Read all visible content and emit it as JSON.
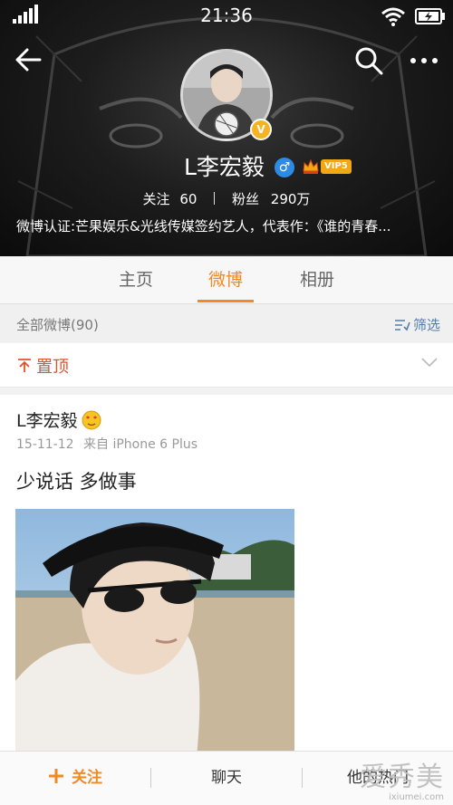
{
  "status_bar": {
    "time": "21:36"
  },
  "profile": {
    "name": "L李宏毅",
    "verified_mark": "V",
    "vip_label": "VIP5",
    "gender_symbol": "♂",
    "following_label": "关注",
    "following_count": "60",
    "followers_label": "粉丝",
    "followers_count": "290万",
    "bio": "微博认证:芒果娱乐&光线传媒签约艺人，代表作：《谁的青春..."
  },
  "tabs": [
    {
      "label": "主页",
      "active": false
    },
    {
      "label": "微博",
      "active": true
    },
    {
      "label": "相册",
      "active": false
    }
  ],
  "filter": {
    "all_posts": "全部微博(90)",
    "filter_label": "筛选"
  },
  "pinned": {
    "label": "置顶"
  },
  "post": {
    "author": "L李宏毅",
    "date": "15-11-12",
    "source": "来自 iPhone 6 Plus",
    "text": "少说话 多做事"
  },
  "bottom_bar": {
    "follow": "关注",
    "chat": "聊天",
    "hot": "他的热门"
  },
  "watermark": {
    "cn": "爱秀美",
    "url": "ixiumei.com"
  },
  "icons": [
    "back-arrow-icon",
    "search-icon",
    "more-icon",
    "signal-icon",
    "wifi-icon",
    "battery-icon",
    "gender-icon",
    "vip-crown-icon",
    "pin-icon",
    "chevron-down-icon",
    "filter-icon",
    "plus-icon"
  ],
  "colors": {
    "accent": "#f08a24",
    "link": "#507daf",
    "pinned": "#e0522e",
    "vip": "#f2a714",
    "verified": "#f5b321",
    "gender": "#2c8be6"
  }
}
